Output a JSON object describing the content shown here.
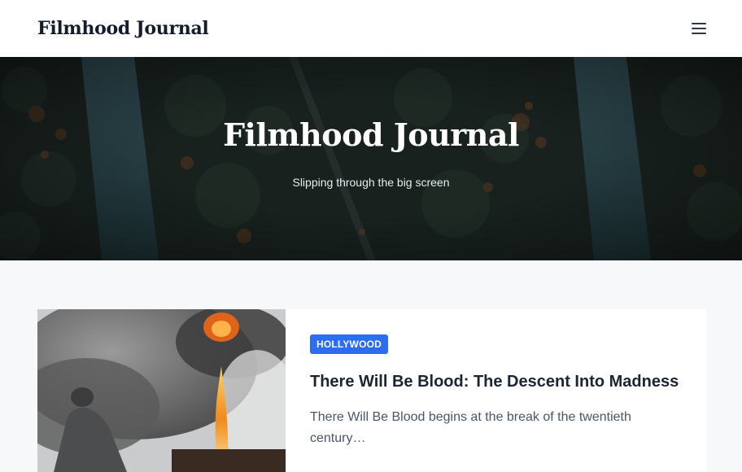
{
  "header": {
    "site_title": "Filmhood Journal"
  },
  "hero": {
    "title": "Filmhood Journal",
    "tagline": "Slipping through the big screen"
  },
  "posts": [
    {
      "category": "HOLLYWOOD",
      "title": "There Will Be Blood: The Descent Into Madness",
      "excerpt": "There Will Be Blood begins at the break of the twentieth century…"
    }
  ],
  "colors": {
    "accent": "#2b6cf0",
    "header_bg": "#ffffff",
    "page_bg": "#f7f8fa"
  }
}
